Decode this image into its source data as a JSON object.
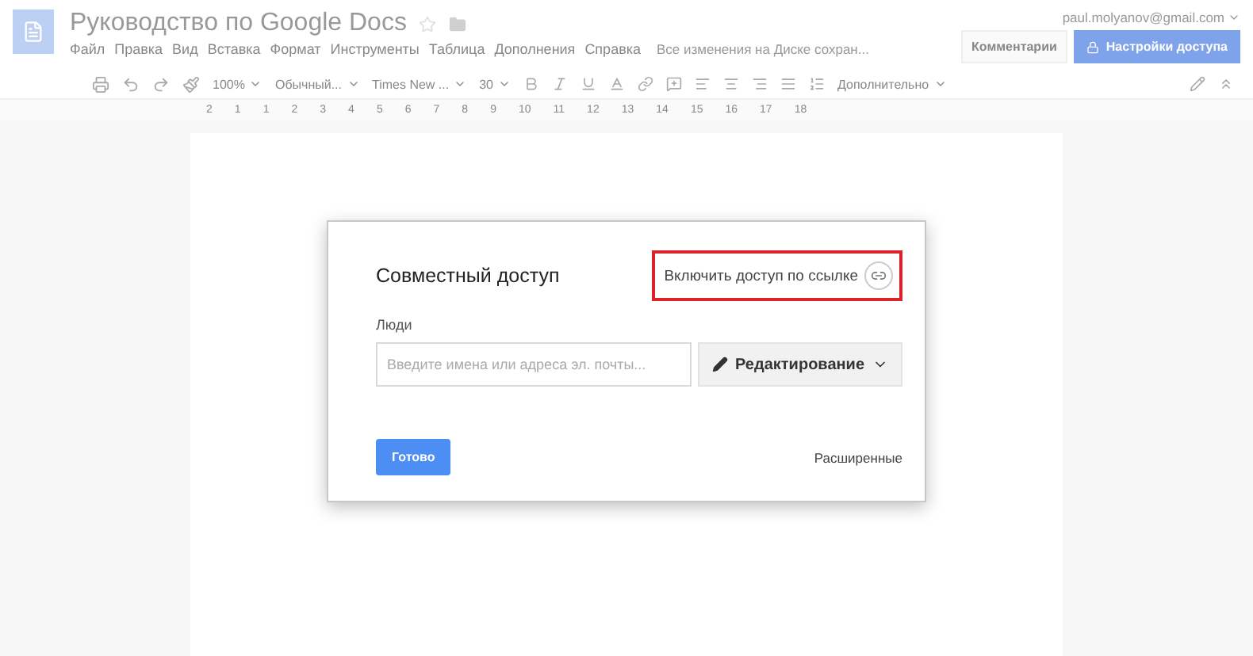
{
  "header": {
    "title": "Руководство по Google Docs",
    "starred": false,
    "menu": [
      "Файл",
      "Правка",
      "Вид",
      "Вставка",
      "Формат",
      "Инструменты",
      "Таблица",
      "Дополнения",
      "Справка"
    ],
    "save_status": "Все изменения на Диске сохран...",
    "account": "paul.molyanov@gmail.com",
    "comments_button": "Комментарии",
    "share_button": "Настройки доступа"
  },
  "toolbar": {
    "zoom": "100%",
    "style": "Обычный...",
    "font": "Times New ...",
    "size": "30",
    "more": "Дополнительно"
  },
  "ruler": [
    "2",
    "1",
    "1",
    "2",
    "3",
    "4",
    "5",
    "6",
    "7",
    "8",
    "9",
    "10",
    "11",
    "12",
    "13",
    "14",
    "15",
    "16",
    "17",
    "18"
  ],
  "dialog": {
    "title": "Совместный доступ",
    "link_sharing": "Включить доступ по ссылке",
    "highlighted": true,
    "people_label": "Люди",
    "people_field": {
      "placeholder": "Введите имена или адреса эл. почты..."
    },
    "permission": "Редактирование",
    "done": "Готово",
    "advanced": "Расширенные"
  }
}
